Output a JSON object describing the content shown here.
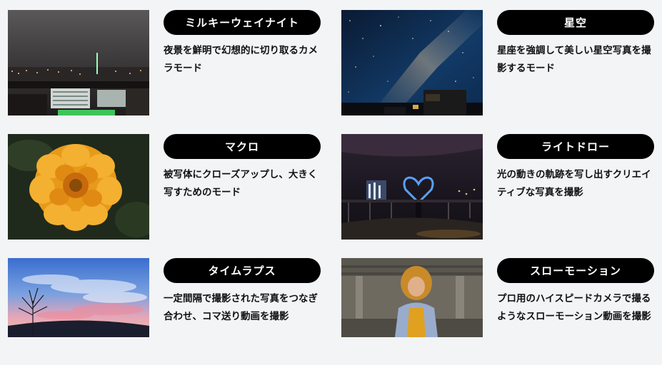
{
  "modes": [
    {
      "title": "ミルキーウェイナイト",
      "description": "夜景を鮮明で幻想的に切り取るカメラモード",
      "image": "night-cityscape"
    },
    {
      "title": "星空",
      "description": "星座を強調して美しい星空写真を撮影するモード",
      "image": "starry-sky-milky-way"
    },
    {
      "title": "マクロ",
      "description": "被写体にクローズアップし、大きく写すためのモード",
      "image": "orange-marigold-flower"
    },
    {
      "title": "ライトドロー",
      "description": "光の動きの軌跡を写し出すクリエイティブな写真を撮影",
      "image": "light-drawn-heart"
    },
    {
      "title": "タイムラプス",
      "description": "一定間隔で撮影された写真をつなぎ合わせ、コマ送り動画を撮影",
      "image": "sunset-sky-fisheye"
    },
    {
      "title": "スローモーション",
      "description": "プロ用のハイスピードカメラで撮るようなスローモーション動画を撮影",
      "image": "person-under-bridge"
    }
  ]
}
